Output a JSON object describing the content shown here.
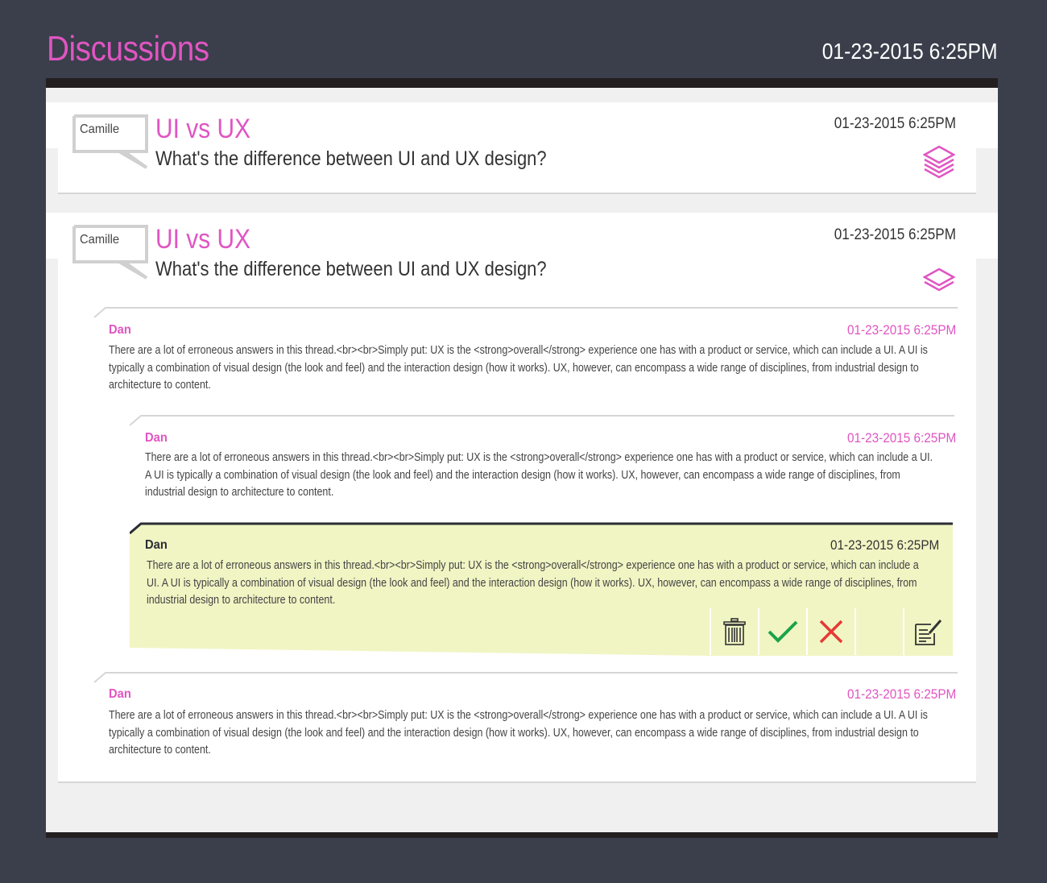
{
  "header": {
    "title": "Discussions",
    "timestamp": "01-23-2015 6:25PM"
  },
  "threads": [
    {
      "author": "Camille",
      "title": "UI vs UX",
      "question": "What's the difference between UI and UX design?",
      "timestamp": "01-23-2015 6:25PM",
      "icon": "layers-icon"
    },
    {
      "author": "Camille",
      "title": "UI vs UX",
      "question": "What's the difference between UI and UX design?",
      "timestamp": "01-23-2015 6:25PM",
      "icon": "layers-collapse-icon",
      "replies": [
        {
          "author": "Dan",
          "timestamp": "01-23-2015 6:25PM",
          "body_lines": [
            "There are a lot of erroneous answers in this thread.<br><br>Simply put: UX is the <strong>overall</strong> experience one has with a product or service, which can include a UI. A UI is",
            "typically a combination of visual design (the look and feel) and the interaction design (how it works). UX, however, can encompass a wide range of disciplines, from industrial design to",
            "architecture to content."
          ]
        },
        {
          "author": "Dan",
          "timestamp": "01-23-2015 6:25PM",
          "body_lines": [
            "There are a lot of erroneous answers in this thread.<br><br>Simply put: UX is the <strong>overall</strong> experience one has with a product or service, which can include a UI.",
            "A UI is typically a combination of visual design (the look and feel) and the interaction design (how it works). UX, however, can encompass a wide range of disciplines, from",
            "industrial design to architecture to content."
          ]
        },
        {
          "author": "Dan",
          "timestamp": "01-23-2015 6:25PM",
          "selected": true,
          "body_lines": [
            "There are a lot of erroneous answers in this thread.<br><br>Simply put: UX is the <strong>overall</strong> experience one has with a product or service, which can include a",
            "UI. A UI is typically a combination of visual design (the look and feel) and the interaction design (how it works). UX, however, can encompass a wide range of disciplines, from",
            "industrial design to architecture to content."
          ],
          "actions": [
            "trash-icon",
            "check-icon",
            "close-icon",
            "edit-icon"
          ]
        },
        {
          "author": "Dan",
          "timestamp": "01-23-2015 6:25PM",
          "body_lines": [
            "There are a lot of erroneous answers in this thread.<br><br>Simply put: UX is the <strong>overall</strong> experience one has with a product or service, which can include a UI. A UI is",
            "typically a combination of visual design (the look and feel) and the interaction design (how it works). UX, however, can encompass a wide range of disciplines, from industrial design to",
            "architecture to content."
          ]
        }
      ]
    }
  ],
  "colors": {
    "background": "#3a3f4b",
    "accent": "#e055c2",
    "highlight": "#f1f5c4",
    "approve": "#1aa34a",
    "reject": "#e53935",
    "divider": "#d6d6d6"
  }
}
